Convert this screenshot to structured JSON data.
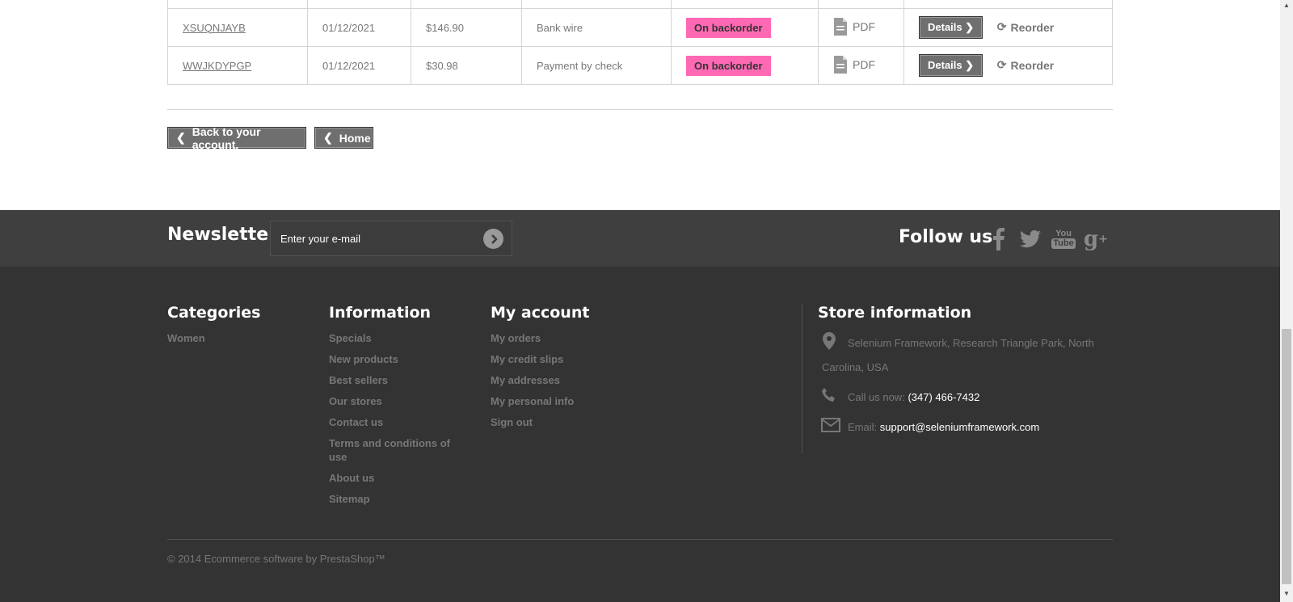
{
  "orders": [
    {
      "ref": "XSUQNJAYB",
      "date": "01/12/2021",
      "price": "$146.90",
      "payment": "Bank wire",
      "status": "On backorder",
      "pdf": "PDF",
      "details": "Details",
      "reorder": "Reorder"
    },
    {
      "ref": "WWJKDYPGP",
      "date": "01/12/2021",
      "price": "$30.98",
      "payment": "Payment by check",
      "status": "On backorder",
      "pdf": "PDF",
      "details": "Details",
      "reorder": "Reorder"
    }
  ],
  "nav": {
    "back_label": "Back to your account.",
    "home_label": "Home"
  },
  "newsletter": {
    "title": "Newsletter",
    "placeholder": "Enter your e-mail"
  },
  "follow": {
    "title": "Follow us",
    "icons": [
      "facebook-icon",
      "twitter-icon",
      "youtube-icon",
      "google-plus-icon"
    ],
    "youtube_text_top": "You",
    "youtube_text_bottom": "Tube"
  },
  "footer": {
    "categories": {
      "title": "Categories",
      "items": [
        "Women"
      ]
    },
    "information": {
      "title": "Information",
      "items": [
        "Specials",
        "New products",
        "Best sellers",
        "Our stores",
        "Contact us",
        "Terms and conditions of use",
        "About us",
        "Sitemap"
      ]
    },
    "account": {
      "title": "My account",
      "items": [
        "My orders",
        "My credit slips",
        "My addresses",
        "My personal info",
        "Sign out"
      ]
    },
    "store": {
      "title": "Store information",
      "address_line1": "Selenium Framework, Research Triangle Park, North",
      "address_line2": "Carolina, USA",
      "phone_label": "Call us now:",
      "phone": "(347) 466-7432",
      "email_label": "Email:",
      "email": "support@seleniumframework.com"
    },
    "copyright": "© 2014 Ecommerce software by PrestaShop™"
  },
  "colors": {
    "status_badge": "#ff69b4",
    "footer_bg": "#333333",
    "newsletter_bg": "#3f3f3f",
    "button_bg": "#6f6f6f"
  }
}
